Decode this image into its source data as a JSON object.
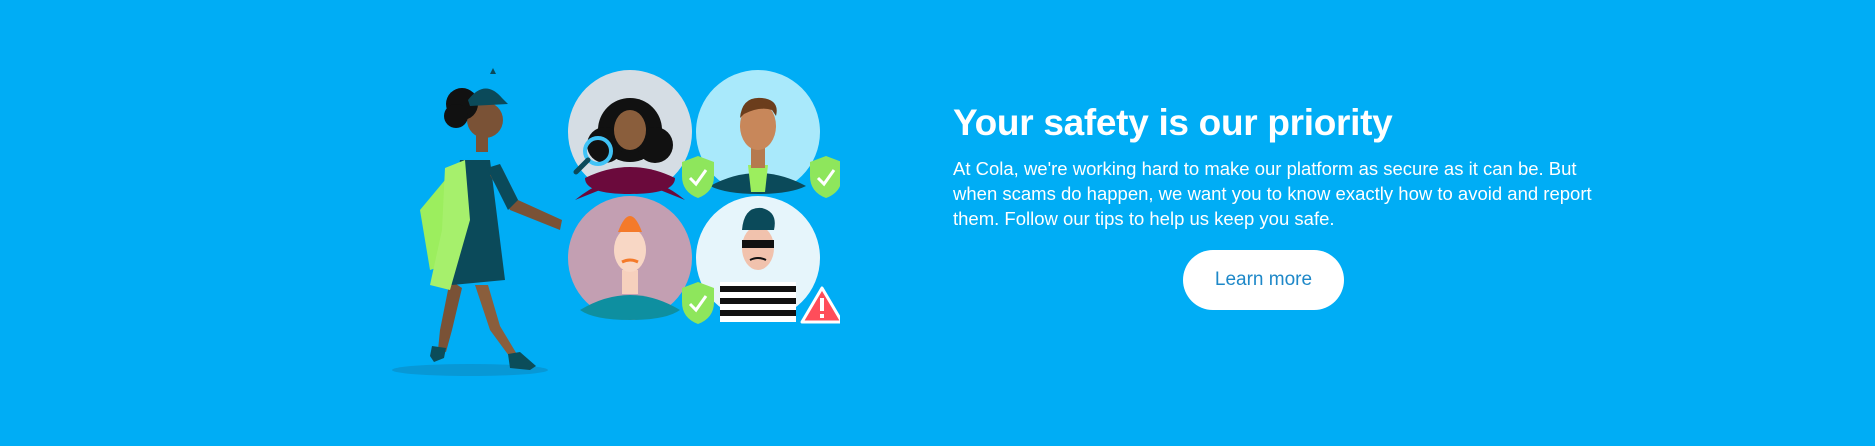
{
  "banner": {
    "title": "Your safety is our priority",
    "body": "At Cola, we're working hard to make our platform as secure as it can be. But when scams do happen, we want you to know exactly how to avoid and report them. Follow our tips to help us keep you safe.",
    "cta_label": "Learn more"
  },
  "colors": {
    "background": "#00adf5",
    "text": "#ffffff",
    "button_bg": "#ffffff",
    "button_text": "#1e88c8",
    "shield_ok": "#8ee65c",
    "warning": "#ff4d5a"
  },
  "illustration": {
    "icons": [
      "detective-woman-icon",
      "magnifying-glass-icon",
      "verified-shield-icon",
      "warning-triangle-icon",
      "scammer-icon"
    ]
  }
}
